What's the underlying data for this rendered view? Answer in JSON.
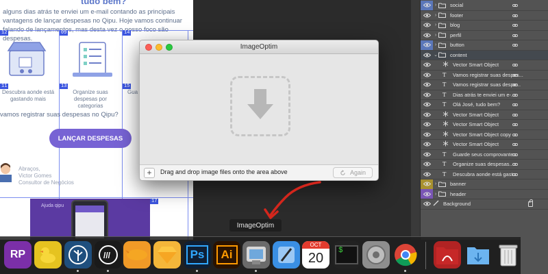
{
  "canvas": {
    "title_fragment": "tudo bem?",
    "paragraph": "alguns dias atrás te enviei um e-mail contando as principais vantagens de lançar despesas no Qipu. Hoje vamos continuar falando de lançamentos, mas desta vez o nosso foco são despesas.",
    "feature1": "Descubra aonde está gastando mais",
    "feature2": "Organize suas despesas por categorias",
    "feature3_fragment": "Gua",
    "question": "vamos registrar suas despesas no Qipu?",
    "cta": "LANÇAR DESPESAS",
    "signature_line1": "Abraços,",
    "signature_line2": "Victor Gomes",
    "signature_line3": "Consultor de Negócios",
    "ajuda": "Ajuda qipu",
    "slice_tags": [
      "12",
      "09",
      "14",
      "11",
      "13",
      "15",
      "16",
      "17"
    ]
  },
  "imageoptim": {
    "title": "ImageOptim",
    "hint": "Drag and drop image files onto the area above",
    "again_label": "Again",
    "plus_label": "+"
  },
  "tooltip": "ImageOptim",
  "layers": [
    {
      "name": "social",
      "kind": "folder",
      "eye_color": "#5b77b9",
      "indent": 0
    },
    {
      "name": "footer",
      "kind": "folder",
      "eye_color": "none",
      "indent": 0
    },
    {
      "name": "blog",
      "kind": "folder",
      "eye_color": "none",
      "indent": 0
    },
    {
      "name": "perfil",
      "kind": "folder",
      "eye_color": "none",
      "indent": 0
    },
    {
      "name": "button",
      "kind": "folder",
      "eye_color": "#5b77b9",
      "indent": 0
    },
    {
      "name": "content",
      "kind": "folder-open",
      "eye_color": "none",
      "indent": 0
    },
    {
      "name": "Vector Smart Object",
      "kind": "smart",
      "eye_color": "none",
      "indent": 1
    },
    {
      "name": "Vamos registrar suas despes...",
      "kind": "text",
      "eye_color": "none",
      "indent": 1
    },
    {
      "name": "Vamos registrar suas despe...",
      "kind": "text",
      "eye_color": "none",
      "indent": 1
    },
    {
      "name": "Dias atrás te enviei um e-...",
      "kind": "text",
      "eye_color": "none",
      "indent": 1
    },
    {
      "name": "Olá José, tudo bem?",
      "kind": "text",
      "eye_color": "none",
      "indent": 1
    },
    {
      "name": "Vector Smart Object",
      "kind": "smart",
      "eye_color": "none",
      "indent": 1
    },
    {
      "name": "Vector Smart Object",
      "kind": "smart",
      "eye_color": "none",
      "indent": 1
    },
    {
      "name": "Vector Smart Object copy",
      "kind": "smart",
      "eye_color": "none",
      "indent": 1
    },
    {
      "name": "Vector Smart Object",
      "kind": "smart",
      "eye_color": "none",
      "indent": 1
    },
    {
      "name": "Guarde seus comprovante...",
      "kind": "text",
      "eye_color": "none",
      "indent": 1
    },
    {
      "name": "Organize suas despesas...",
      "kind": "text",
      "eye_color": "none",
      "indent": 1
    },
    {
      "name": "Descubra aonde está gast...",
      "kind": "text",
      "eye_color": "none",
      "indent": 1
    },
    {
      "name": "banner",
      "kind": "folder",
      "eye_color": "#a8912f",
      "indent": 0
    },
    {
      "name": "header",
      "kind": "folder",
      "eye_color": "#7a56b5",
      "indent": 0
    },
    {
      "name": "Background",
      "kind": "background",
      "eye_color": "none",
      "indent": 0
    }
  ],
  "dock": [
    {
      "name": "rightfont",
      "label": "RP",
      "bg": "#7b2fa8",
      "running": false
    },
    {
      "name": "cyberduck",
      "label": "",
      "bg": "#e5c320",
      "running": false
    },
    {
      "name": "sourcetree",
      "label": "",
      "bg": "#1f4f7e",
      "running": true
    },
    {
      "name": "linear",
      "label": "///",
      "bg": "#1a1a1a",
      "running": true
    },
    {
      "name": "zeplin",
      "label": "",
      "bg": "#f19a27",
      "running": false
    },
    {
      "name": "sketch",
      "label": "",
      "bg": "#f4b63a",
      "running": false
    },
    {
      "name": "photoshop",
      "label": "Ps",
      "bg": "#0f1f34",
      "running": true
    },
    {
      "name": "illustrator",
      "label": "Ai",
      "bg": "#2a1200",
      "running": false
    },
    {
      "name": "imageoptim",
      "label": "",
      "bg": "#6b6b6b",
      "running": true
    },
    {
      "name": "xcode",
      "label": "",
      "bg": "#3a8fe4",
      "running": false
    },
    {
      "name": "calendar",
      "label": "20",
      "bg": "#ffffff",
      "running": false
    },
    {
      "name": "terminal",
      "label": "$",
      "bg": "#222222",
      "running": false
    },
    {
      "name": "system-preferences",
      "label": "",
      "bg": "#8e8e8e",
      "running": false
    },
    {
      "name": "chrome",
      "label": "",
      "bg": "#ffffff",
      "running": true
    },
    {
      "name": "acrobat-folder",
      "label": "",
      "bg": "#b12323",
      "running": false
    },
    {
      "name": "downloads-folder",
      "label": "",
      "bg": "#5aa4e7",
      "running": false
    },
    {
      "name": "trash",
      "label": "",
      "bg": "#d9d9d9",
      "running": false
    }
  ],
  "calendar_month": "OCT"
}
